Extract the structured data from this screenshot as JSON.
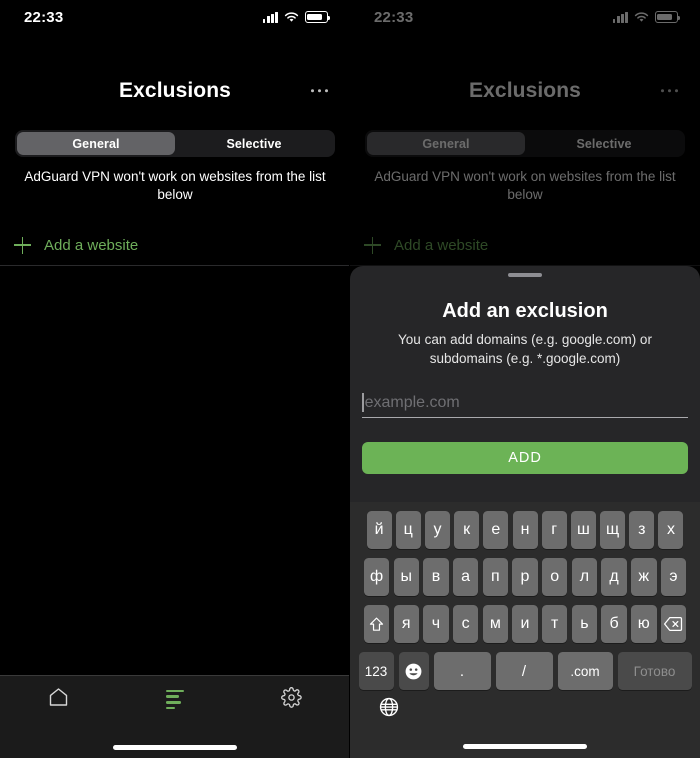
{
  "status_bar": {
    "time": "22:33",
    "signal_icon": "cellular-bars-icon",
    "wifi_icon": "wifi-icon",
    "battery_icon": "battery-icon"
  },
  "screen_left": {
    "nav": {
      "title": "Exclusions",
      "more_icon": "more-horizontal-icon"
    },
    "segmented": {
      "options": [
        "General",
        "Selective"
      ],
      "selected": "General"
    },
    "hint": "AdGuard VPN won't work on websites from the list below",
    "add_row": {
      "label": "Add a website",
      "icon": "plus-icon"
    },
    "tab_bar": {
      "items": [
        {
          "name": "home",
          "icon": "home-icon",
          "active": false
        },
        {
          "name": "exclusions",
          "icon": "list-lines-icon",
          "active": true
        },
        {
          "name": "settings",
          "icon": "gear-icon",
          "active": false
        }
      ]
    }
  },
  "screen_right": {
    "nav": {
      "title": "Exclusions",
      "more_icon": "more-horizontal-icon"
    },
    "segmented": {
      "options": [
        "General",
        "Selective"
      ],
      "selected": "General"
    },
    "hint": "AdGuard VPN won't work on websites from the list below",
    "add_row": {
      "label": "Add a website",
      "icon": "plus-icon"
    },
    "sheet": {
      "grabber": "sheet-grabber",
      "title": "Add an exclusion",
      "subtitle": "You can add domains (e.g. google.com) or subdomains (e.g. *.google.com)",
      "input": {
        "value": "",
        "placeholder": "example.com"
      },
      "submit_label": "ADD"
    },
    "keyboard": {
      "layout": "ru-ЙЦУКЕН",
      "row1": [
        "й",
        "ц",
        "у",
        "к",
        "е",
        "н",
        "г",
        "ш",
        "щ",
        "з",
        "х"
      ],
      "row2": [
        "ф",
        "ы",
        "в",
        "а",
        "п",
        "р",
        "о",
        "л",
        "д",
        "ж",
        "э"
      ],
      "row3_letters": [
        "я",
        "ч",
        "с",
        "м",
        "и",
        "т",
        "ь",
        "б",
        "ю"
      ],
      "shift_icon": "shift-up-icon",
      "backspace_icon": "backspace-icon",
      "row4": {
        "numbers_label": "123",
        "emoji_icon": "emoji-smiley-icon",
        "period_label": ".",
        "slash_label": "/",
        "dotcom_label": ".com",
        "done_label": "Готово"
      },
      "globe_icon": "globe-icon"
    }
  },
  "colors": {
    "accent_green": "#6fae5b",
    "button_green": "#6cb356",
    "key_gray": "#6d6d6d",
    "keyboard_bg": "#2c2c2c",
    "sheet_bg": "#262628"
  }
}
